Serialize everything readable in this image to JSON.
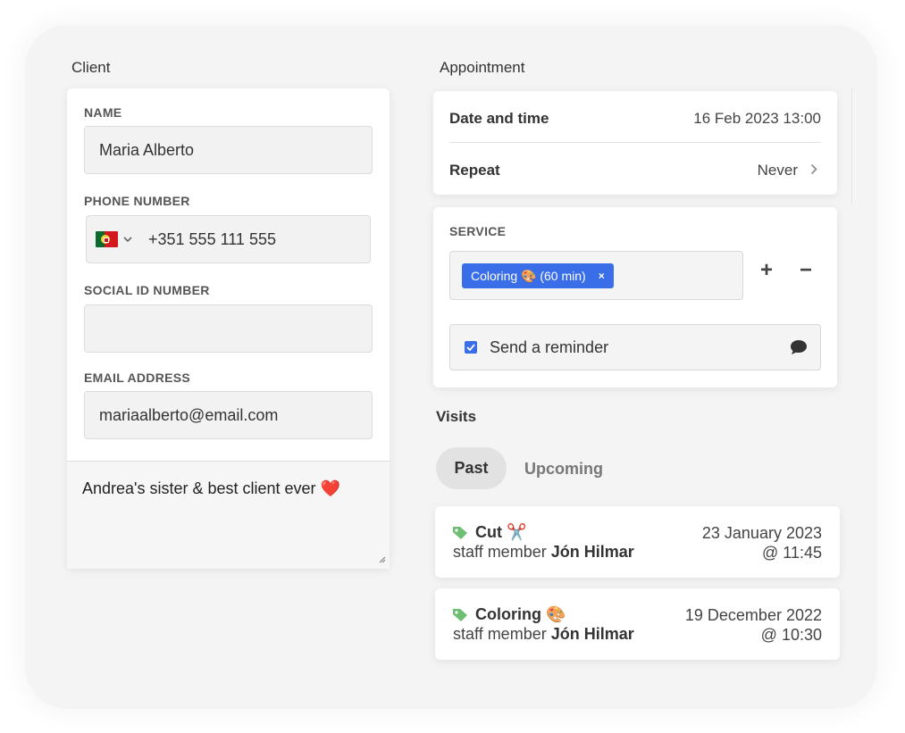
{
  "client": {
    "title": "Client",
    "name_label": "NAME",
    "name_value": "Maria Alberto",
    "phone_label": "PHONE NUMBER",
    "phone_value": "+351 555 111 555",
    "phone_country_icon": "portugal-flag-icon",
    "social_label": "SOCIAL ID NUMBER",
    "social_value": "",
    "email_label": "EMAIL ADDRESS",
    "email_value": "mariaalberto@email.com",
    "notes": "Andrea's sister & best client ever",
    "notes_emoji": "❤️"
  },
  "appointment": {
    "title": "Appointment",
    "date_label": "Date and time",
    "date_value": "16 Feb 2023 13:00",
    "repeat_label": "Repeat",
    "repeat_value": "Never",
    "service_label": "SERVICE",
    "service_chip": "Coloring 🎨 (60 min)",
    "chip_remove": "×",
    "add_symbol": "+",
    "remove_symbol": "−",
    "reminder_label": "Send a reminder",
    "reminder_checked": true
  },
  "visits": {
    "title": "Visits",
    "tab_past": "Past",
    "tab_upcoming": "Upcoming",
    "items": [
      {
        "service": "Cut ✂️",
        "staff_prefix": "staff member",
        "staff_name": "Jón Hilmar",
        "date": "23 January 2023",
        "time": "@ 11:45"
      },
      {
        "service": "Coloring 🎨",
        "staff_prefix": "staff member",
        "staff_name": "Jón Hilmar",
        "date": "19 December 2022",
        "time": "@ 10:30"
      }
    ]
  },
  "colors": {
    "accent": "#3a6ee8",
    "tag_green": "#6fbf73",
    "background": "#f4f4f4"
  }
}
